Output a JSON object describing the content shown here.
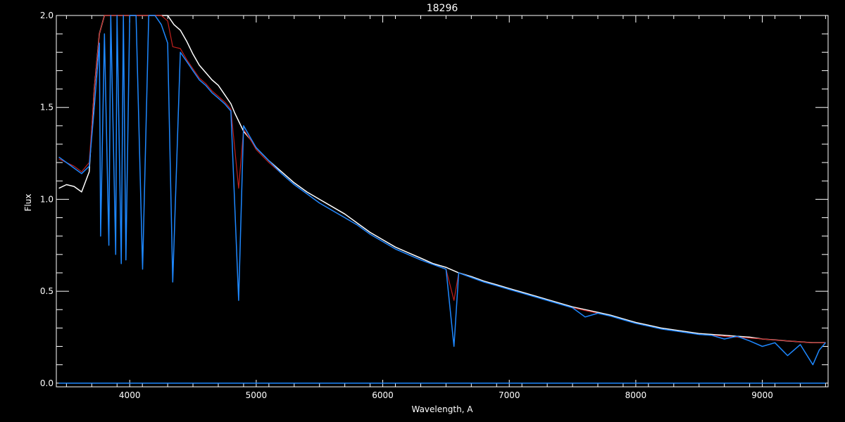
{
  "chart_data": {
    "type": "line",
    "title": "18296",
    "xlabel": "Wavelength, A",
    "ylabel": "Flux",
    "xlim": [
      3420,
      9520
    ],
    "ylim": [
      -0.02,
      2.0
    ],
    "x_ticks": [
      4000,
      5000,
      6000,
      7000,
      8000,
      9000
    ],
    "x_tick_labels": [
      "4000",
      "5000",
      "6000",
      "7000",
      "8000",
      "9000"
    ],
    "y_ticks": [
      0.0,
      0.5,
      1.0,
      1.5,
      2.0
    ],
    "y_tick_labels": [
      "0.0",
      "0.5",
      "1.0",
      "1.5",
      "2.0"
    ],
    "grid": false,
    "legend": "none",
    "series": [
      {
        "color": "#ffffff",
        "x": [
          3440,
          3500,
          3560,
          3620,
          3680,
          3720,
          3760,
          3800,
          3850,
          3900,
          3950,
          4000,
          4050,
          4100,
          4150,
          4200,
          4250,
          4300,
          4350,
          4400,
          4450,
          4500,
          4550,
          4600,
          4650,
          4700,
          4750,
          4800,
          4830,
          4900,
          4950,
          5000,
          5100,
          5200,
          5300,
          5400,
          5500,
          5600,
          5700,
          5800,
          5900,
          6000,
          6100,
          6200,
          6300,
          6400,
          6500,
          6600,
          6700,
          6800,
          6900,
          7000,
          7100,
          7200,
          7300,
          7400,
          7500,
          7600,
          7700,
          7800,
          7900,
          8000,
          8100,
          8200,
          8300,
          8400,
          8500,
          8600,
          8700,
          8800,
          8900,
          9000,
          9100,
          9200,
          9300,
          9400,
          9500
        ],
        "y": [
          1.06,
          1.08,
          1.07,
          1.04,
          1.15,
          1.6,
          1.9,
          2.0,
          2.0,
          2.0,
          2.0,
          2.0,
          2.0,
          2.0,
          2.0,
          2.0,
          2.0,
          2.0,
          1.95,
          1.92,
          1.86,
          1.79,
          1.73,
          1.69,
          1.65,
          1.62,
          1.57,
          1.52,
          1.47,
          1.37,
          1.33,
          1.28,
          1.21,
          1.15,
          1.09,
          1.04,
          1.0,
          0.96,
          0.92,
          0.87,
          0.82,
          0.78,
          0.74,
          0.71,
          0.68,
          0.65,
          0.63,
          0.6,
          0.58,
          0.555,
          0.535,
          0.515,
          0.495,
          0.475,
          0.455,
          0.435,
          0.415,
          0.4,
          0.385,
          0.37,
          0.35,
          0.33,
          0.315,
          0.3,
          0.29,
          0.28,
          0.27,
          0.265,
          0.26,
          0.255,
          0.25,
          0.24,
          0.235,
          0.23,
          0.225,
          0.22,
          0.22
        ]
      },
      {
        "color": "#c0201e",
        "x": [
          3440,
          3500,
          3560,
          3620,
          3680,
          3720,
          3760,
          3800,
          3850,
          3900,
          3950,
          4000,
          4050,
          4100,
          4150,
          4200,
          4250,
          4300,
          4340,
          4400,
          4450,
          4500,
          4550,
          4600,
          4650,
          4700,
          4750,
          4800,
          4861,
          4900,
          4950,
          5000,
          5100,
          5200,
          5300,
          5400,
          5500,
          5600,
          5700,
          5800,
          5900,
          6000,
          6100,
          6200,
          6300,
          6400,
          6500,
          6563,
          6600,
          6700,
          6800,
          6900,
          7000,
          7100,
          7200,
          7300,
          7400,
          7500,
          7600,
          7700,
          7800,
          7900,
          8000,
          8100,
          8200,
          8300,
          8400,
          8500,
          8600,
          8700,
          8800,
          8900,
          9000,
          9100,
          9200,
          9300,
          9400,
          9500
        ],
        "y": [
          1.22,
          1.2,
          1.18,
          1.15,
          1.2,
          1.6,
          1.9,
          2.0,
          2.0,
          2.0,
          2.0,
          2.0,
          2.0,
          2.0,
          2.0,
          2.0,
          2.0,
          1.97,
          1.83,
          1.82,
          1.76,
          1.71,
          1.66,
          1.63,
          1.59,
          1.56,
          1.53,
          1.49,
          1.06,
          1.38,
          1.33,
          1.27,
          1.2,
          1.14,
          1.08,
          1.03,
          0.98,
          0.94,
          0.9,
          0.86,
          0.81,
          0.77,
          0.73,
          0.7,
          0.67,
          0.645,
          0.62,
          0.45,
          0.6,
          0.575,
          0.55,
          0.53,
          0.51,
          0.49,
          0.47,
          0.45,
          0.43,
          0.41,
          0.395,
          0.38,
          0.365,
          0.345,
          0.325,
          0.31,
          0.295,
          0.285,
          0.275,
          0.265,
          0.26,
          0.255,
          0.25,
          0.245,
          0.24,
          0.235,
          0.23,
          0.225,
          0.22,
          0.22
        ]
      },
      {
        "color": "#1e88ff",
        "x": [
          3440,
          3500,
          3560,
          3620,
          3680,
          3720,
          3760,
          3770,
          3800,
          3835,
          3850,
          3889,
          3900,
          3933,
          3950,
          3970,
          4000,
          4050,
          4102,
          4150,
          4200,
          4250,
          4300,
          4340,
          4400,
          4450,
          4500,
          4550,
          4600,
          4650,
          4700,
          4750,
          4800,
          4861,
          4900,
          4950,
          5000,
          5100,
          5200,
          5300,
          5400,
          5500,
          5600,
          5700,
          5800,
          5900,
          6000,
          6100,
          6200,
          6300,
          6400,
          6500,
          6563,
          6600,
          6700,
          6800,
          6900,
          7000,
          7100,
          7200,
          7300,
          7400,
          7500,
          7600,
          7700,
          7800,
          7900,
          8000,
          8100,
          8200,
          8300,
          8400,
          8500,
          8600,
          8700,
          8800,
          8900,
          9000,
          9100,
          9200,
          9300,
          9400,
          9450,
          9500
        ],
        "y": [
          1.23,
          1.2,
          1.17,
          1.14,
          1.18,
          1.5,
          1.85,
          0.8,
          1.9,
          0.75,
          2.0,
          0.7,
          2.0,
          0.65,
          2.0,
          0.67,
          2.0,
          2.0,
          0.62,
          2.0,
          2.0,
          1.95,
          1.85,
          0.55,
          1.8,
          1.75,
          1.7,
          1.65,
          1.62,
          1.58,
          1.55,
          1.52,
          1.48,
          0.45,
          1.4,
          1.34,
          1.28,
          1.21,
          1.14,
          1.08,
          1.03,
          0.98,
          0.94,
          0.9,
          0.86,
          0.81,
          0.77,
          0.73,
          0.7,
          0.67,
          0.645,
          0.62,
          0.2,
          0.6,
          0.575,
          0.55,
          0.53,
          0.51,
          0.49,
          0.47,
          0.45,
          0.43,
          0.41,
          0.36,
          0.38,
          0.365,
          0.345,
          0.325,
          0.31,
          0.295,
          0.285,
          0.275,
          0.265,
          0.26,
          0.24,
          0.255,
          0.23,
          0.2,
          0.22,
          0.15,
          0.21,
          0.1,
          0.18,
          0.22
        ]
      },
      {
        "color": "#1e88ff",
        "x": [
          3440,
          4000,
          5000,
          6000,
          7000,
          8000,
          9000,
          9500
        ],
        "y": [
          0.0,
          0.0,
          0.0,
          0.0,
          0.0,
          0.0,
          0.0,
          0.0
        ]
      }
    ]
  }
}
